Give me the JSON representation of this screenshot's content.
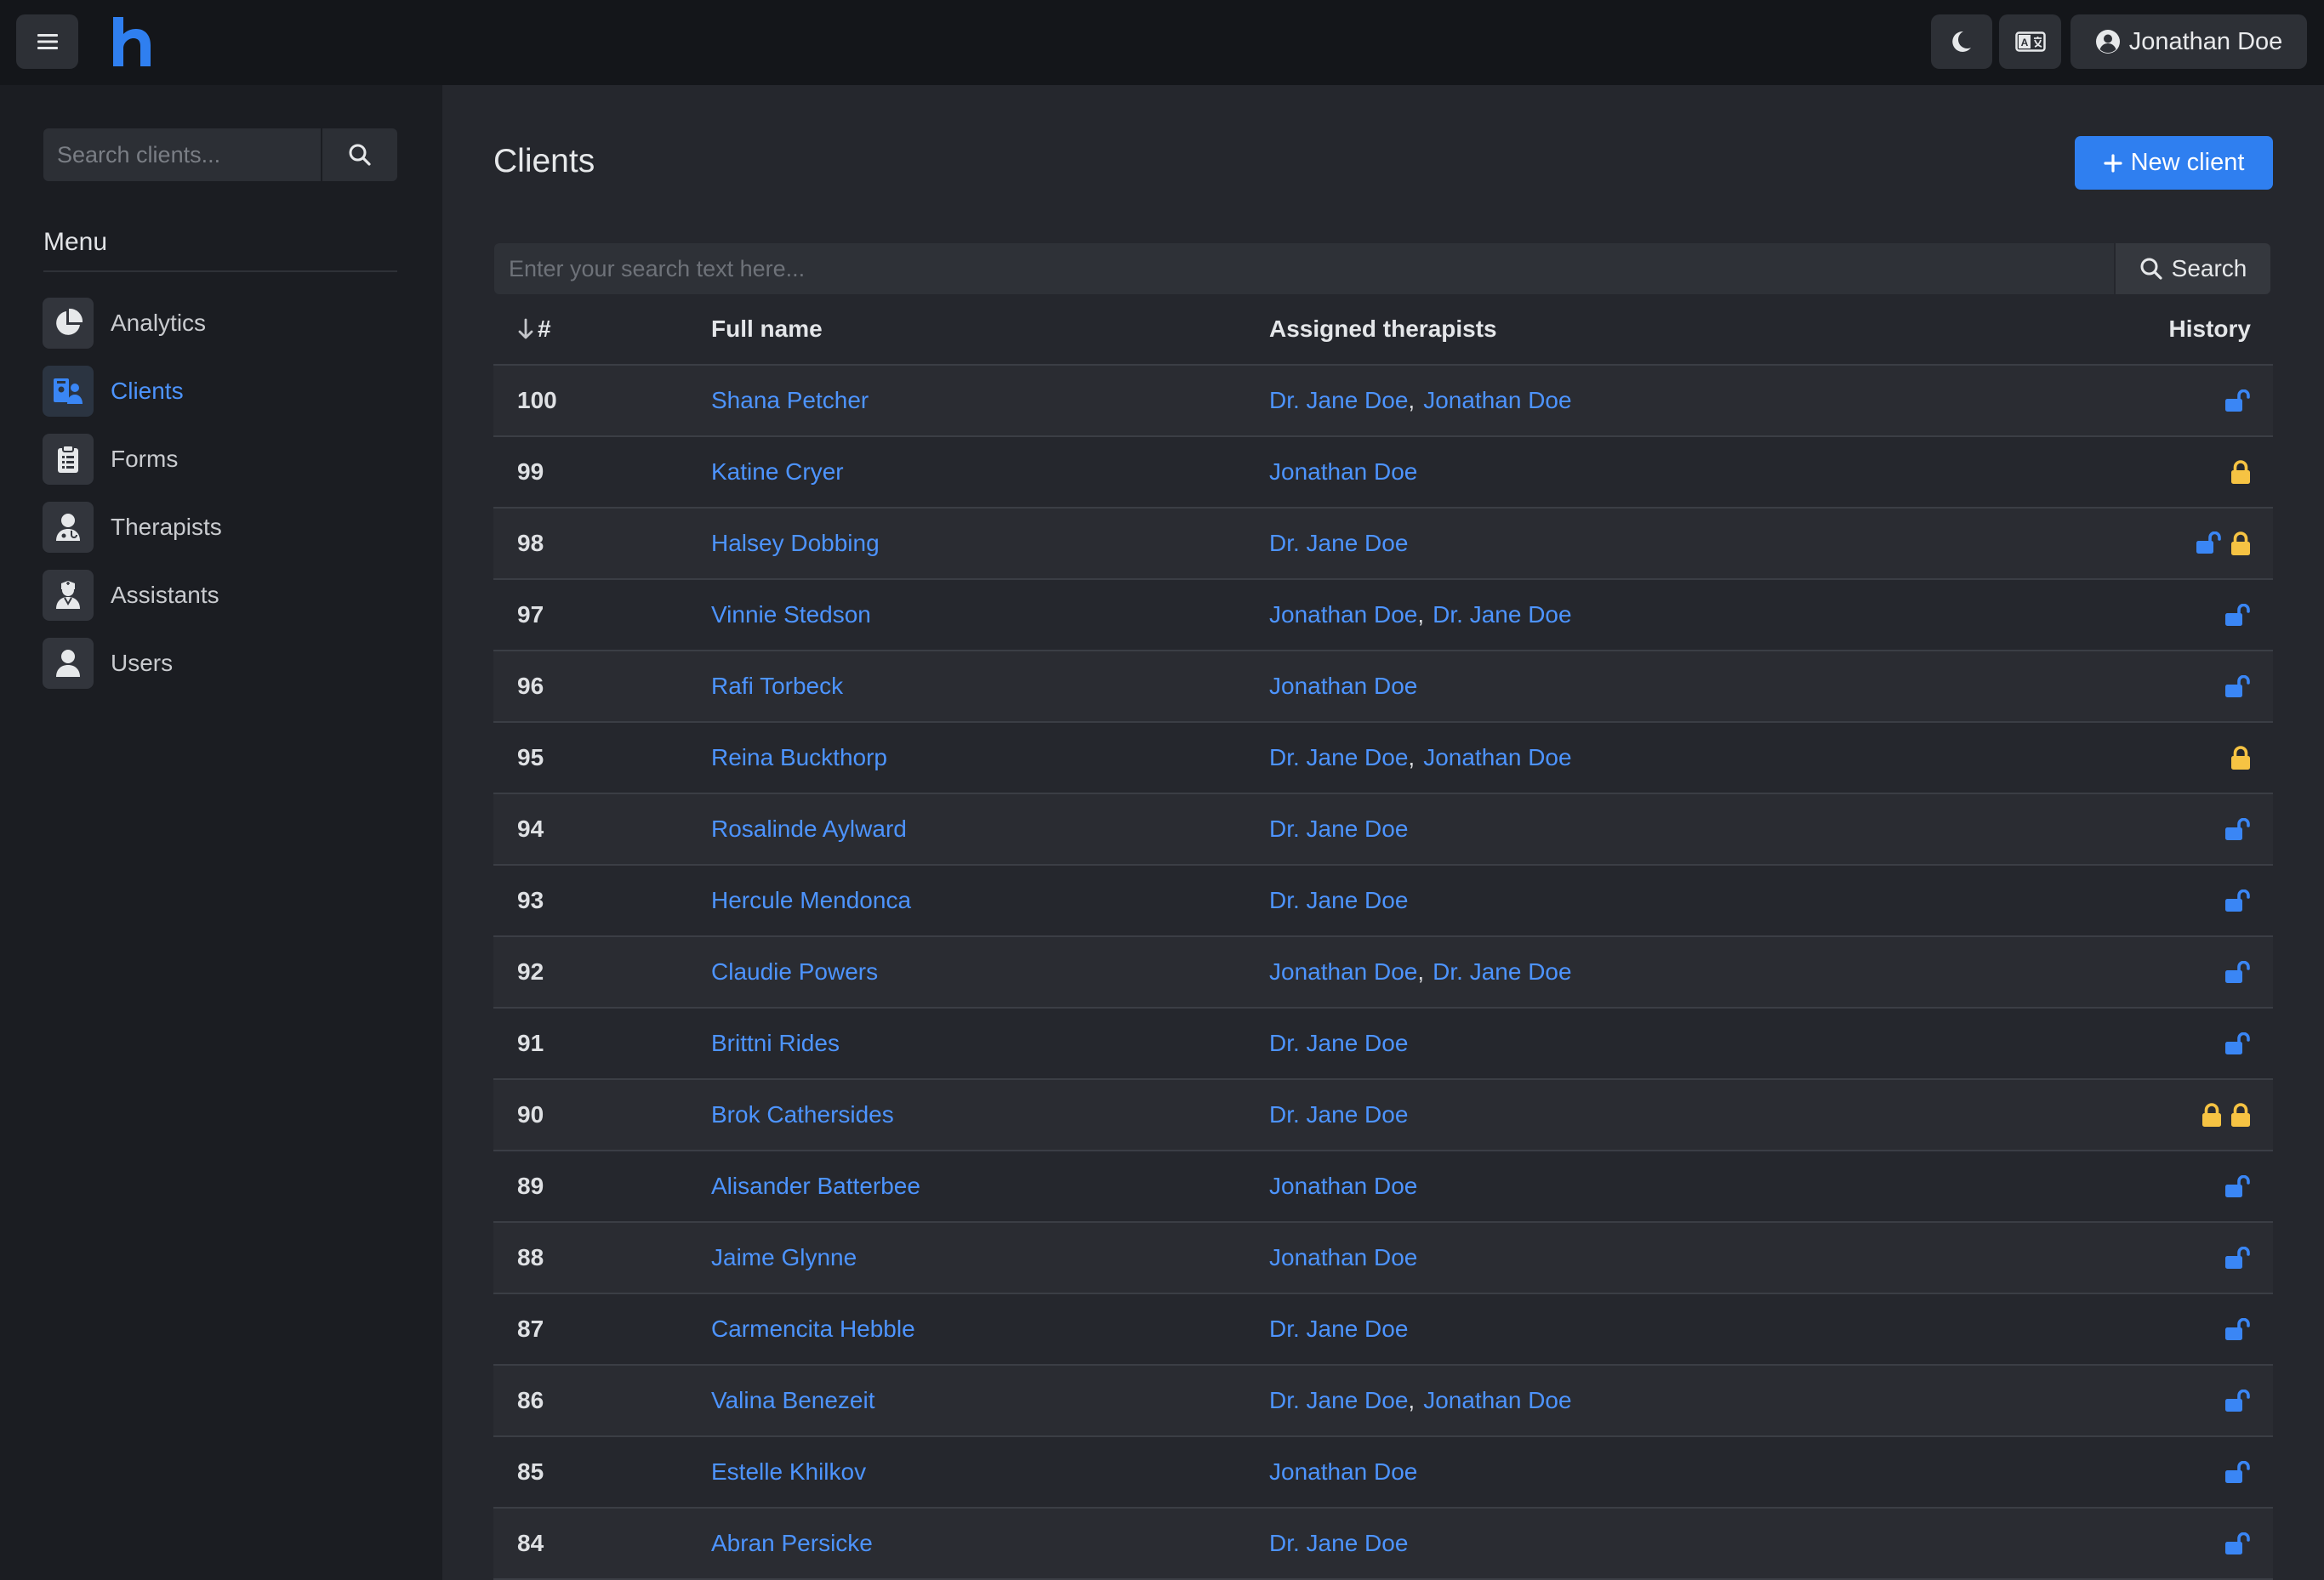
{
  "header": {
    "user_name": "Jonathan Doe"
  },
  "sidebar": {
    "search_placeholder": "Search clients...",
    "menu_title": "Menu",
    "items": [
      {
        "label": "Analytics",
        "icon": "pie-chart-icon",
        "active": false
      },
      {
        "label": "Clients",
        "icon": "clients-icon",
        "active": true
      },
      {
        "label": "Forms",
        "icon": "clipboard-icon",
        "active": false
      },
      {
        "label": "Therapists",
        "icon": "user-doctor-icon",
        "active": false
      },
      {
        "label": "Assistants",
        "icon": "user-nurse-icon",
        "active": false
      },
      {
        "label": "Users",
        "icon": "user-icon",
        "active": false
      }
    ]
  },
  "main": {
    "title": "Clients",
    "new_client_label": "New client",
    "search_placeholder": "Enter your search text here...",
    "search_label": "Search",
    "columns": {
      "id": "#",
      "name": "Full name",
      "therapists": "Assigned therapists",
      "history": "History"
    },
    "rows": [
      {
        "id": "100",
        "name": "Shana Petcher",
        "therapists": [
          "Dr. Jane Doe",
          "Jonathan Doe"
        ],
        "history": [
          "unlocked"
        ]
      },
      {
        "id": "99",
        "name": "Katine Cryer",
        "therapists": [
          "Jonathan Doe"
        ],
        "history": [
          "locked"
        ]
      },
      {
        "id": "98",
        "name": "Halsey Dobbing",
        "therapists": [
          "Dr. Jane Doe"
        ],
        "history": [
          "unlocked",
          "locked"
        ]
      },
      {
        "id": "97",
        "name": "Vinnie Stedson",
        "therapists": [
          "Jonathan Doe",
          "Dr. Jane Doe"
        ],
        "history": [
          "unlocked"
        ]
      },
      {
        "id": "96",
        "name": "Rafi Torbeck",
        "therapists": [
          "Jonathan Doe"
        ],
        "history": [
          "unlocked"
        ]
      },
      {
        "id": "95",
        "name": "Reina Buckthorp",
        "therapists": [
          "Dr. Jane Doe",
          "Jonathan Doe"
        ],
        "history": [
          "locked"
        ]
      },
      {
        "id": "94",
        "name": "Rosalinde Aylward",
        "therapists": [
          "Dr. Jane Doe"
        ],
        "history": [
          "unlocked"
        ]
      },
      {
        "id": "93",
        "name": "Hercule Mendonca",
        "therapists": [
          "Dr. Jane Doe"
        ],
        "history": [
          "unlocked"
        ]
      },
      {
        "id": "92",
        "name": "Claudie Powers",
        "therapists": [
          "Jonathan Doe",
          "Dr. Jane Doe"
        ],
        "history": [
          "unlocked"
        ]
      },
      {
        "id": "91",
        "name": "Brittni Rides",
        "therapists": [
          "Dr. Jane Doe"
        ],
        "history": [
          "unlocked"
        ]
      },
      {
        "id": "90",
        "name": "Brok Cathersides",
        "therapists": [
          "Dr. Jane Doe"
        ],
        "history": [
          "locked",
          "locked"
        ]
      },
      {
        "id": "89",
        "name": "Alisander Batterbee",
        "therapists": [
          "Jonathan Doe"
        ],
        "history": [
          "unlocked"
        ]
      },
      {
        "id": "88",
        "name": "Jaime Glynne",
        "therapists": [
          "Jonathan Doe"
        ],
        "history": [
          "unlocked"
        ]
      },
      {
        "id": "87",
        "name": "Carmencita Hebble",
        "therapists": [
          "Dr. Jane Doe"
        ],
        "history": [
          "unlocked"
        ]
      },
      {
        "id": "86",
        "name": "Valina Benezeit",
        "therapists": [
          "Dr. Jane Doe",
          "Jonathan Doe"
        ],
        "history": [
          "unlocked"
        ]
      },
      {
        "id": "85",
        "name": "Estelle Khilkov",
        "therapists": [
          "Jonathan Doe"
        ],
        "history": [
          "unlocked"
        ]
      },
      {
        "id": "84",
        "name": "Abran Persicke",
        "therapists": [
          "Dr. Jane Doe"
        ],
        "history": [
          "unlocked"
        ]
      }
    ]
  },
  "colors": {
    "accent": "#2f7ff0",
    "link": "#4d94ff",
    "lock_unlocked": "#3a86f5",
    "lock_locked": "#f6c343"
  }
}
